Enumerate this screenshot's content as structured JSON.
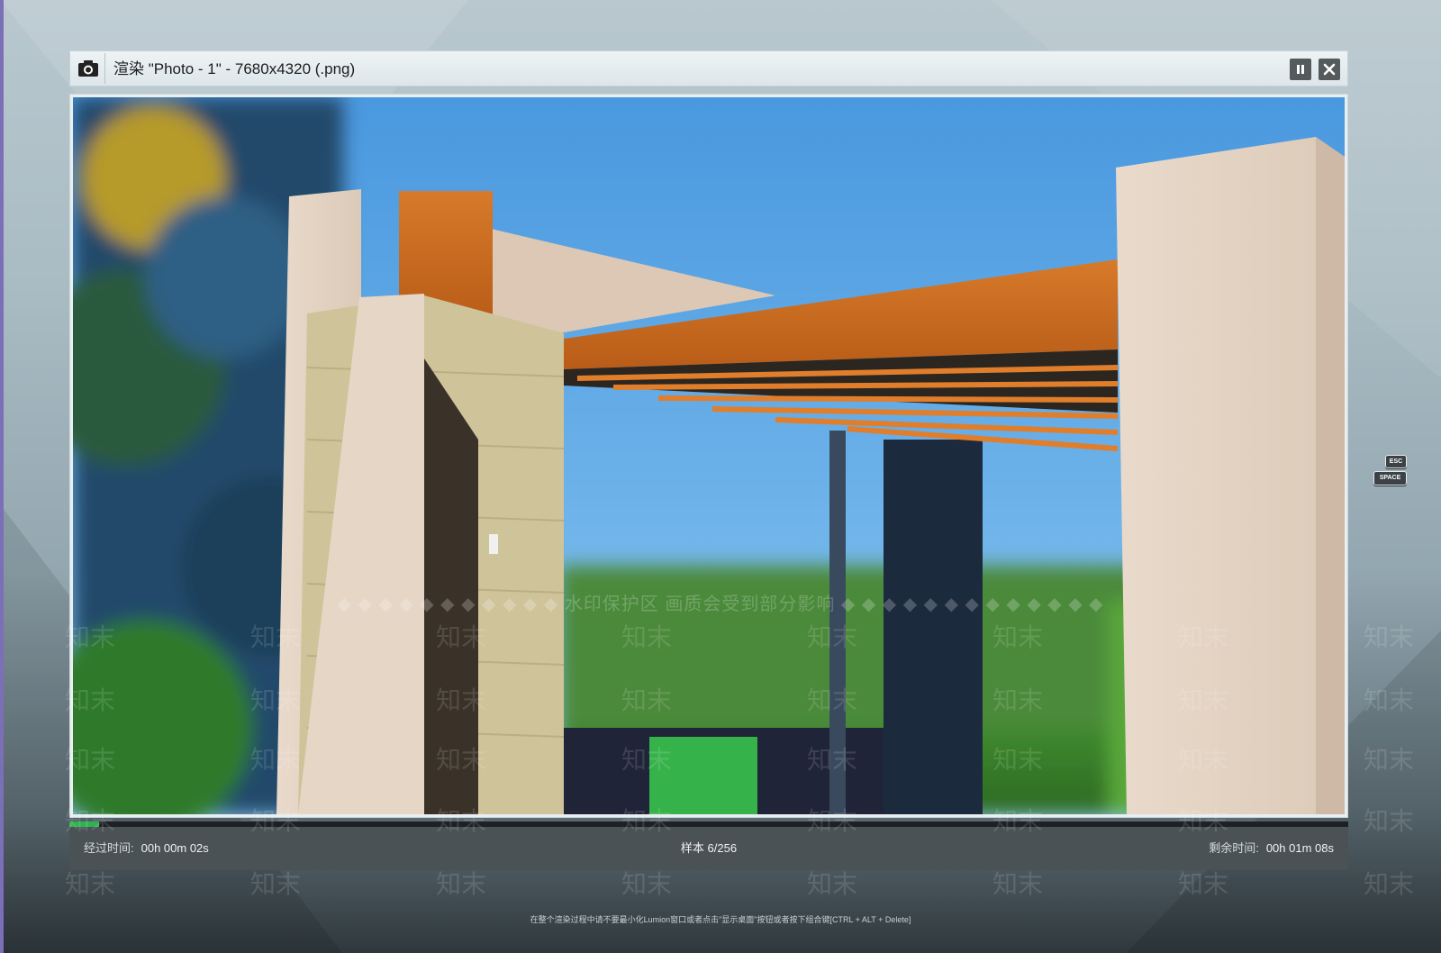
{
  "window": {
    "title": "渲染 \"Photo - 1\" - 7680x4320 (.png)",
    "camera_icon": "camera-icon",
    "pause_icon": "pause-icon",
    "close_icon": "close-icon"
  },
  "progress": {
    "fraction": 0.0234,
    "color": "#2fb350"
  },
  "status": {
    "elapsed_label": "经过时间:",
    "elapsed_value": "00h 00m 02s",
    "sample": "样本 6/256",
    "remaining_label": "剩余时间:",
    "remaining_value": "00h 01m 08s"
  },
  "keys": {
    "esc": "ESC",
    "space": "SPACE"
  },
  "footer_note": "在整个渲染过程中请不要最小化Lumion窗口或者点击\"显示桌面\"按钮或者按下组合键[CTRL + ALT + Delete]",
  "watermark": {
    "banner": "◆ ◆ ◆ ◆ ◆ ◆ ◆ ◆ ◆ ◆ ◆ 水印保护区  画质会受到部分影响 ◆ ◆ ◆ ◆ ◆ ◆ ◆ ◆ ◆ ◆ ◆ ◆ ◆",
    "text": "知末"
  },
  "colors": {
    "status_bar": "#4a5256",
    "title_bar": "#e5ecef",
    "sky": "#4f9ee0",
    "wood_light": "#e7d7c8",
    "wood_orange": "#c8681e"
  }
}
